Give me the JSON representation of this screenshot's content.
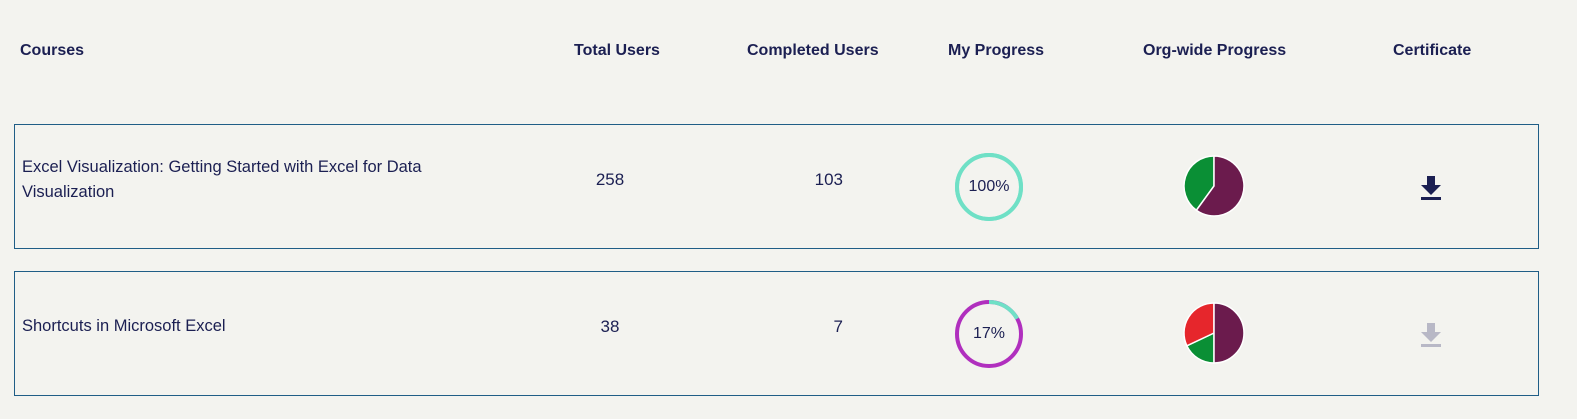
{
  "header": {
    "courses": "Courses",
    "total_users": "Total Users",
    "completed_users": "Completed Users",
    "my_progress": "My Progress",
    "org_progress": "Org-wide Progress",
    "certificate": "Certificate"
  },
  "rows": [
    {
      "title": "Excel Visualization: Getting Started with Excel for Data Visualization",
      "total_users": "258",
      "completed_users": "103",
      "my_progress_label": "100%",
      "my_progress": 1.0,
      "ring_color": "#6fe0c6",
      "ring_track_color": "#6fe0c6",
      "org_progress": [
        {
          "value": 0.4,
          "color": "#0a8f35"
        },
        {
          "value": 0.6,
          "color": "#6b1b4d"
        }
      ],
      "certificate_available": true
    },
    {
      "title": "Shortcuts in Microsoft Excel",
      "total_users": "38",
      "completed_users": "7",
      "my_progress_label": "17%",
      "my_progress": 0.17,
      "ring_color": "#6fe0c6",
      "ring_track_color": "#b02fbe",
      "org_progress": [
        {
          "value": 0.18,
          "color": "#0a8f35"
        },
        {
          "value": 0.32,
          "color": "#e6262c"
        },
        {
          "value": 0.5,
          "color": "#6b1b4d"
        }
      ],
      "certificate_available": false
    }
  ],
  "colors": {
    "text": "#1b1f52",
    "row_border": "#1f5d86",
    "background": "#f3f3ef",
    "download_active": "#1b1f52",
    "download_disabled": "#b8b8c6"
  },
  "icons": {
    "download": "download-icon"
  }
}
